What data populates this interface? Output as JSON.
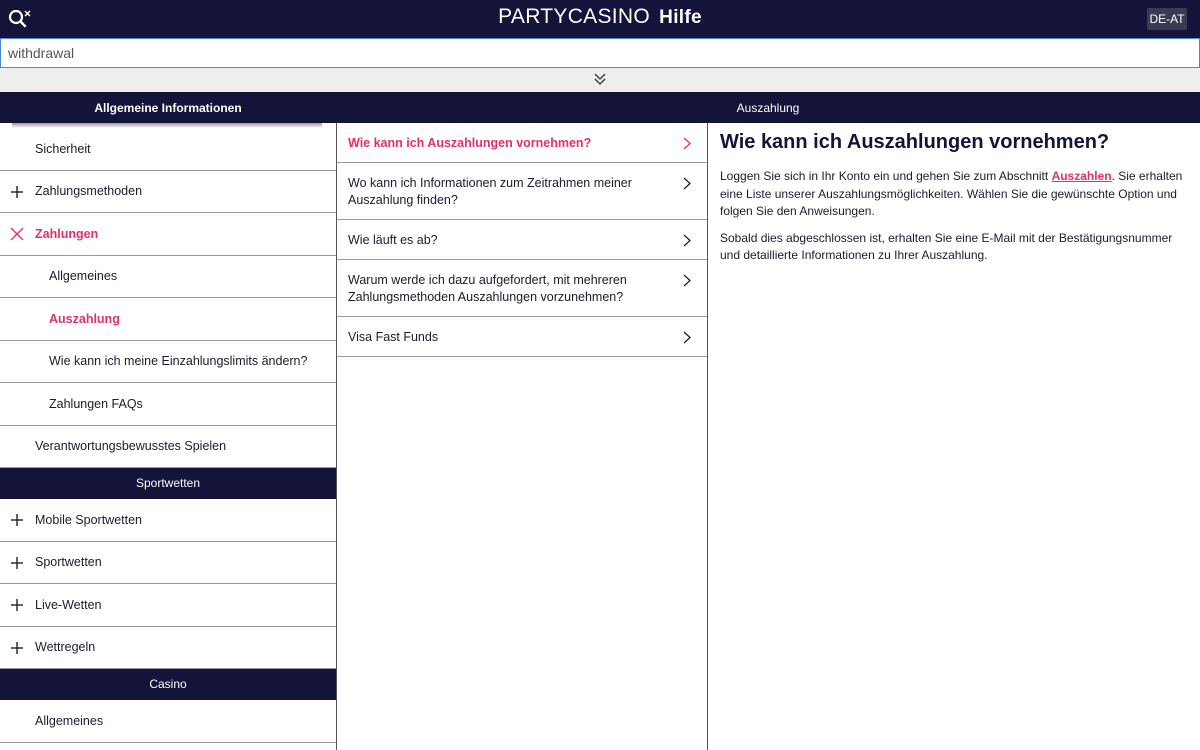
{
  "header": {
    "search_icon": "search-close-icon",
    "brand_logo": "PARTYCASINO",
    "brand_suffix": "Hilfe",
    "language": "DE-AT"
  },
  "search": {
    "value": "withdrawal"
  },
  "expander_icon": "double-chevron-down-icon",
  "breadcrumb": {
    "left": "Allgemeine Informationen",
    "right": "Auszahlung"
  },
  "sidebar": {
    "items": [
      {
        "label": "Sicherheit",
        "icon": "none"
      },
      {
        "label": "Zahlungsmethoden",
        "icon": "plus-icon"
      },
      {
        "label": "Zahlungen",
        "icon": "close-icon"
      },
      {
        "label": "Allgemeines",
        "icon": "none"
      },
      {
        "label": "Auszahlung",
        "icon": "none"
      },
      {
        "label": "Wie kann ich meine Einzahlungslimits ändern?",
        "icon": "none"
      },
      {
        "label": "Zahlungen FAQs",
        "icon": "none"
      },
      {
        "label": "Verantwortungsbewusstes Spielen",
        "icon": "none"
      }
    ],
    "sport_head": "Sportwetten",
    "sport_items": [
      {
        "label": "Mobile Sportwetten",
        "icon": "plus-icon"
      },
      {
        "label": "Sportwetten",
        "icon": "plus-icon"
      },
      {
        "label": "Live-Wetten",
        "icon": "plus-icon"
      },
      {
        "label": "Wettregeln",
        "icon": "plus-icon"
      }
    ],
    "casino_head": "Casino",
    "casino_items": [
      {
        "label": "Allgemeines",
        "icon": "none"
      }
    ]
  },
  "questions": [
    {
      "label": "Wie kann ich Auszahlungen vornehmen?"
    },
    {
      "label": "Wo kann ich Informationen zum Zeitrahmen meiner Auszahlung finden?"
    },
    {
      "label": "Wie läuft es ab?"
    },
    {
      "label": "Warum werde ich dazu aufgefordert, mit mehreren Zahlungsmethoden Auszahlungen vorzunehmen?"
    },
    {
      "label": "Visa Fast Funds"
    }
  ],
  "article": {
    "title": "Wie kann ich Auszahlungen vornehmen?",
    "p1_before": "Loggen Sie sich in Ihr Konto ein und gehen Sie zum Abschnitt ",
    "p1_link": "Auszahlen",
    "p1_after": ". Sie erhalten eine Liste unserer Auszahlungsmöglichkeiten. Wählen Sie die gewünschte Option und folgen Sie den Anweisungen.",
    "p2": "Sobald dies abgeschlossen ist, erhalten Sie eine E-Mail mit der Bestätigungsnummer und detaillierte Informationen zu Ihrer Auszahlung."
  },
  "colors": {
    "navy": "#14133a",
    "accent": "#e3306a"
  }
}
